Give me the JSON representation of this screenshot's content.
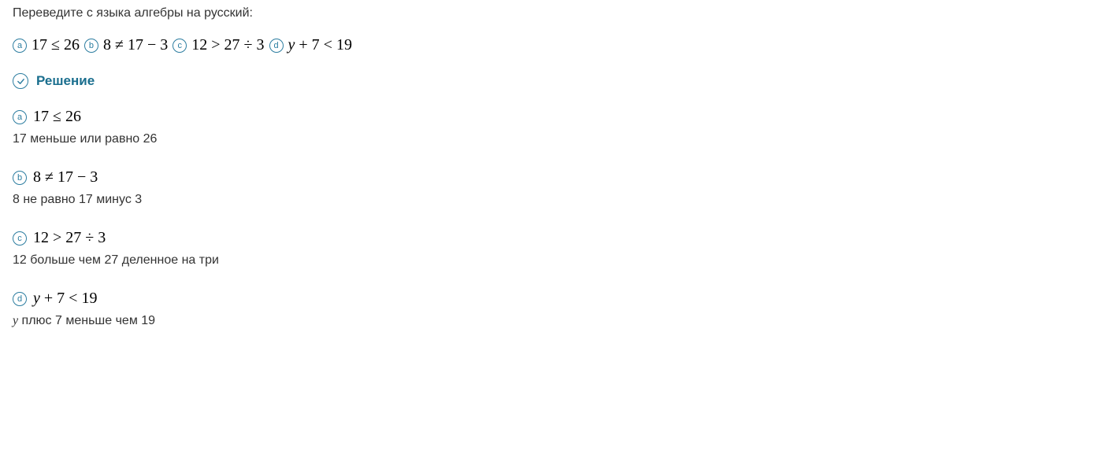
{
  "question": "Переведите с языка алгебры на русский:",
  "problems": {
    "a": {
      "marker": "a",
      "expr": "17 ≤ 26"
    },
    "b": {
      "marker": "b",
      "expr": "8 ≠ 17 − 3"
    },
    "c": {
      "marker": "c",
      "expr": "12 > 27 ÷ 3"
    },
    "d": {
      "marker": "d",
      "expr_pre": "y",
      "expr_post": " + 7 < 19"
    }
  },
  "solution_label": "Решение",
  "solutions": {
    "a": {
      "marker": "a",
      "expr": "17 ≤ 26",
      "text": "17 меньше или равно 26"
    },
    "b": {
      "marker": "b",
      "expr": "8 ≠ 17 − 3",
      "text": "8 не равно 17 минус 3"
    },
    "c": {
      "marker": "c",
      "expr": "12 > 27 ÷ 3",
      "text": "12 больше чем 27 деленное на три"
    },
    "d": {
      "marker": "d",
      "expr_pre": "y",
      "expr_post": " + 7 < 19",
      "text_pre": "y",
      "text_post": " плюс 7 меньше чем 19"
    }
  }
}
